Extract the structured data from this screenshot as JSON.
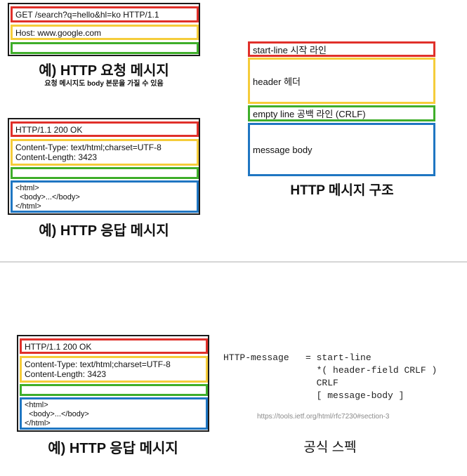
{
  "request_example": {
    "start_line": "GET /search?q=hello&hl=ko HTTP/1.1",
    "header": "Host: www.google.com",
    "empty_line": "",
    "caption": "예) HTTP 요청 메시지",
    "note": "요청 메시지도 body 본문을 가질 수 있음"
  },
  "response_example": {
    "start_line": "HTTP/1.1 200 OK",
    "headers": "Content-Type: text/html;charset=UTF-8\nContent-Length: 3423",
    "empty_line": "",
    "body": "<html>\n  <body>...</body>\n</html>",
    "caption": "예) HTTP 응답 메시지"
  },
  "structure": {
    "start_line": "start-line 시작 라인",
    "header": "header 헤더",
    "empty_line": "empty line 공백 라인 (CRLF)",
    "message_body": "message body",
    "caption": "HTTP 메시지 구조"
  },
  "response_example_2": {
    "start_line": "HTTP/1.1 200 OK",
    "headers": "Content-Type: text/html;charset=UTF-8\nContent-Length: 3423",
    "empty_line": "",
    "body": "<html>\n  <body>...</body>\n</html>",
    "caption": "예) HTTP 응답 메시지"
  },
  "spec": {
    "grammar": "HTTP-message   = start-line\n                 *( header-field CRLF )\n                 CRLF\n                 [ message-body ]",
    "url": "https://tools.ietf.org/html/rfc7230#section-3",
    "caption": "공식 스펙"
  },
  "colors": {
    "start_line": "#e0302a",
    "header": "#f5cc3a",
    "empty_line": "#3fae2a",
    "body": "#1f76c2"
  }
}
